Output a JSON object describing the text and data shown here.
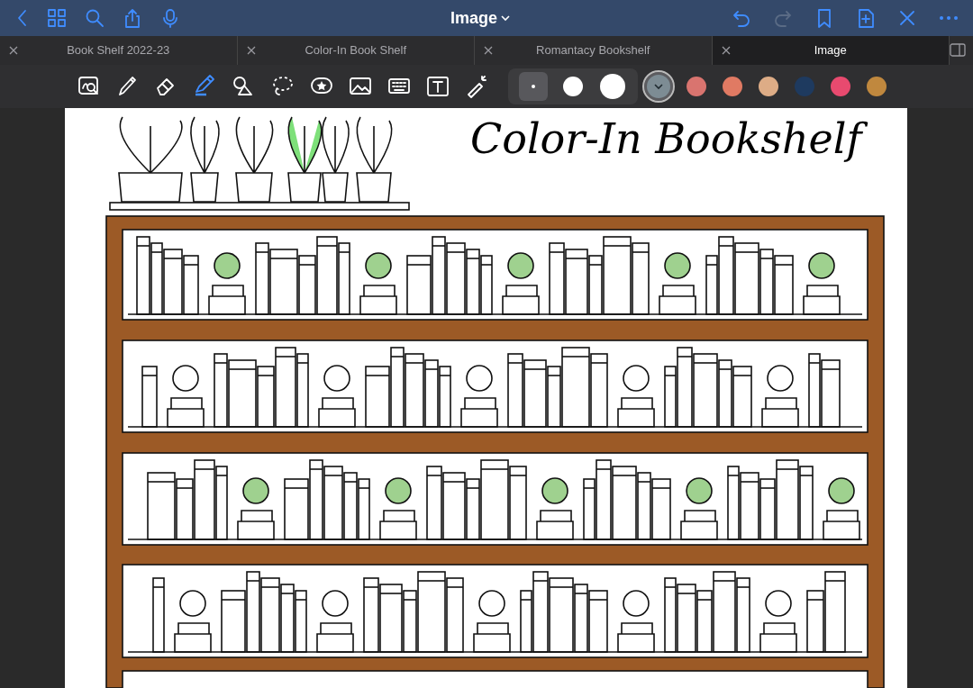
{
  "nav": {
    "title": "Image"
  },
  "tabs": [
    {
      "label": "Book Shelf 2022-23",
      "selected": false
    },
    {
      "label": "Color-In Book Shelf",
      "selected": false
    },
    {
      "label": "Romantacy Bookshelf",
      "selected": false
    },
    {
      "label": "Image",
      "selected": true
    }
  ],
  "tools": [
    {
      "kind": "zoom",
      "selected": false
    },
    {
      "kind": "pen",
      "selected": false
    },
    {
      "kind": "eraser",
      "selected": false
    },
    {
      "kind": "highlighter",
      "selected": true
    },
    {
      "kind": "shapes",
      "selected": false
    },
    {
      "kind": "lasso",
      "selected": false
    },
    {
      "kind": "sticker",
      "selected": false
    },
    {
      "kind": "image",
      "selected": false
    },
    {
      "kind": "keyboard",
      "selected": false
    },
    {
      "kind": "text",
      "selected": false
    },
    {
      "kind": "laser",
      "selected": false
    }
  ],
  "sizes": [
    {
      "kind": "small",
      "selected": true
    },
    {
      "kind": "medium",
      "selected": false
    },
    {
      "kind": "large",
      "selected": false
    }
  ],
  "colors": [
    {
      "color": "#7d8c94",
      "selected": true
    },
    {
      "color": "#d9746f",
      "selected": false
    },
    {
      "color": "#e07a63",
      "selected": false
    },
    {
      "color": "#ddac86",
      "selected": false
    },
    {
      "color": "#1e3a5f",
      "selected": false
    },
    {
      "color": "#e84a6f",
      "selected": false
    },
    {
      "color": "#c0883e",
      "selected": false
    }
  ],
  "document": {
    "title": "Color-In Bookshelf"
  }
}
